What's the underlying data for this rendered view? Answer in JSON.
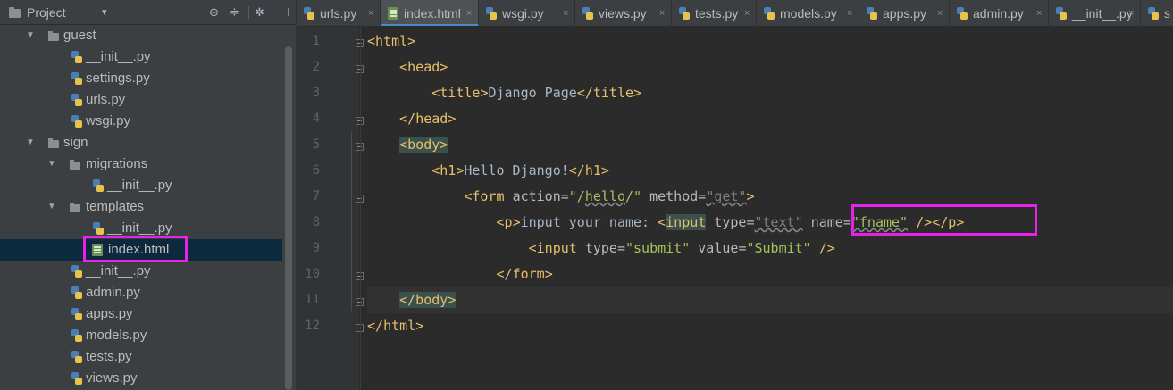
{
  "project_panel": {
    "title": "Project",
    "dropdown_glyph": "▾",
    "toolbar_icons": [
      "target-icon",
      "collapse-icon",
      "gear-icon",
      "hide-icon"
    ],
    "tree": [
      {
        "label": "guest",
        "kind": "folder",
        "expanded": true
      },
      {
        "label": "__init__.py",
        "kind": "py"
      },
      {
        "label": "settings.py",
        "kind": "py"
      },
      {
        "label": "urls.py",
        "kind": "py"
      },
      {
        "label": "wsgi.py",
        "kind": "py"
      },
      {
        "label": "sign",
        "kind": "folder",
        "expanded": true
      },
      {
        "label": "migrations",
        "kind": "folder",
        "expanded": true
      },
      {
        "label": "__init__.py",
        "kind": "py"
      },
      {
        "label": "templates",
        "kind": "folder",
        "expanded": true
      },
      {
        "label": "__init__.py",
        "kind": "py"
      },
      {
        "label": "index.html",
        "kind": "html",
        "selected": true
      },
      {
        "label": "__init__.py",
        "kind": "py"
      },
      {
        "label": "admin.py",
        "kind": "py"
      },
      {
        "label": "apps.py",
        "kind": "py"
      },
      {
        "label": "models.py",
        "kind": "py"
      },
      {
        "label": "tests.py",
        "kind": "py"
      },
      {
        "label": "views.py",
        "kind": "py"
      }
    ]
  },
  "tabs": [
    {
      "label": "urls.py",
      "kind": "py"
    },
    {
      "label": "index.html",
      "kind": "html",
      "active": true
    },
    {
      "label": "wsgi.py",
      "kind": "py"
    },
    {
      "label": "views.py",
      "kind": "py"
    },
    {
      "label": "tests.py",
      "kind": "py"
    },
    {
      "label": "models.py",
      "kind": "py"
    },
    {
      "label": "apps.py",
      "kind": "py"
    },
    {
      "label": "admin.py",
      "kind": "py"
    },
    {
      "label": "__init__.py",
      "kind": "py"
    },
    {
      "label": "s",
      "kind": "py"
    }
  ],
  "tab_close_glyph": "×",
  "editor": {
    "line_numbers": [
      "1",
      "2",
      "3",
      "4",
      "5",
      "6",
      "7",
      "8",
      "9",
      "10",
      "11",
      "12"
    ],
    "lines": [
      {
        "text": "<html>"
      },
      {
        "text": "    <head>"
      },
      {
        "text": "        <title>Django Page</title>"
      },
      {
        "text": "    </head>"
      },
      {
        "text": "    <body>"
      },
      {
        "text": "        <h1>Hello Django!</h1>"
      },
      {
        "text": "            <form action=\"/hello/\" method=\"get\">"
      },
      {
        "text": "                <p>input your name: <input type=\"text\" name=\"fname\" /></p>"
      },
      {
        "text": "                    <input type=\"submit\" value=\"Submit\" />"
      },
      {
        "text": "                </form>"
      },
      {
        "text": "    </body>"
      },
      {
        "text": "</html>"
      }
    ]
  },
  "colors": {
    "highlight_box": "#e722e7",
    "tag": "#e8bf6a",
    "string": "#a5c25c",
    "selection": "#0d293e"
  }
}
